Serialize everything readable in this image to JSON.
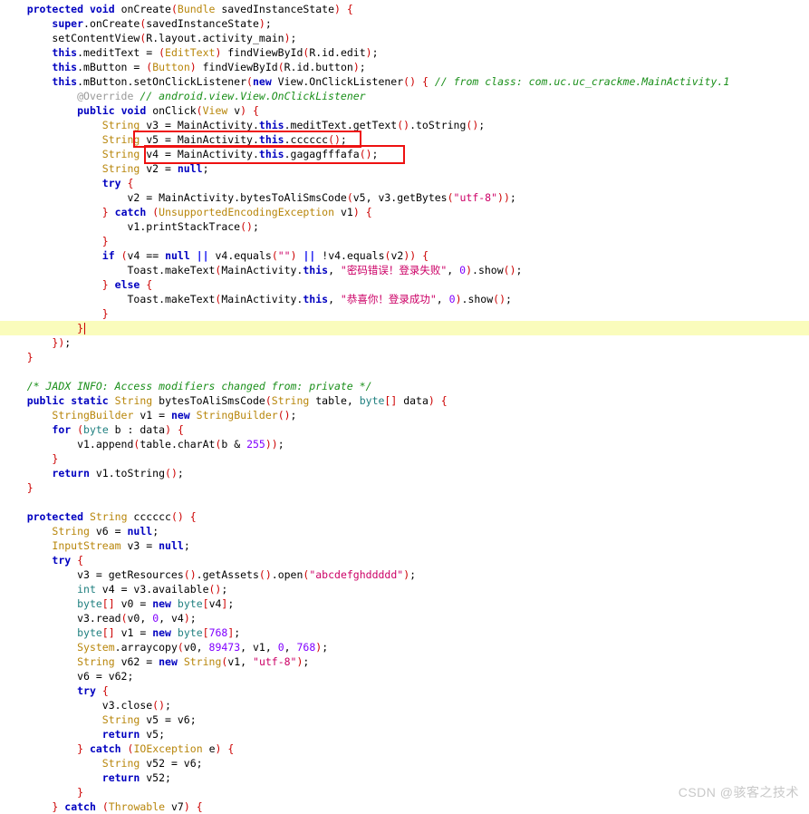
{
  "app": {
    "kind": "decompiler-code-view",
    "title": "JADX decompiled Java source",
    "watermark": "CSDN @骇客之技术"
  },
  "theme": {
    "background": "#ffffff",
    "keyword": "#0000c0",
    "class_name": "#b8860b",
    "string": "#cc0066",
    "number": "#8000ff",
    "comment": "#1a8f1a",
    "punctuation": "#cc0000",
    "annotation": "#999999",
    "highlight_line": "#fafcbc",
    "annotation_box": "#ee1111",
    "watermark": "#c8c8c8"
  },
  "annotations": {
    "boxes": [
      {
        "name": "highlight-box-cccccc",
        "target_text": "v5 = MainActivity.this.cccccc();"
      },
      {
        "name": "highlight-box-gagagfffafa",
        "target_text": "v4 = MainActivity.this.gagagfffafa();"
      }
    ],
    "highlighted_line_index": 21
  },
  "code": {
    "lines": [
      "    protected void onCreate(Bundle savedInstanceState) {",
      "        super.onCreate(savedInstanceState);",
      "        setContentView(R.layout.activity_main);",
      "        this.meditText = (EditText) findViewById(R.id.edit);",
      "        this.mButton = (Button) findViewById(R.id.button);",
      "        this.mButton.setOnClickListener(new View.OnClickListener() { // from class: com.uc.uc_crackme.MainActivity.1",
      "            @Override // android.view.View.OnClickListener",
      "            public void onClick(View v) {",
      "                String v3 = MainActivity.this.meditText.getText().toString();",
      "                String v5 = MainActivity.this.cccccc();",
      "                String v4 = MainActivity.this.gagagfffafa();",
      "                String v2 = null;",
      "                try {",
      "                    v2 = MainActivity.bytesToAliSmsCode(v5, v3.getBytes(\"utf-8\"));",
      "                } catch (UnsupportedEncodingException v1) {",
      "                    v1.printStackTrace();",
      "                }",
      "                if (v4 == null || v4.equals(\"\") || !v4.equals(v2)) {",
      "                    Toast.makeText(MainActivity.this, \"密码错误！登录失败\", 0).show();",
      "                } else {",
      "                    Toast.makeText(MainActivity.this, \"恭喜你！登录成功\", 0).show();",
      "                }",
      "            }",
      "        });",
      "    }",
      "",
      "    /* JADX INFO: Access modifiers changed from: private */",
      "    public static String bytesToAliSmsCode(String table, byte[] data) {",
      "        StringBuilder v1 = new StringBuilder();",
      "        for (byte b : data) {",
      "            v1.append(table.charAt(b & 255));",
      "        }",
      "        return v1.toString();",
      "    }",
      "",
      "    protected String cccccc() {",
      "        String v6 = null;",
      "        InputStream v3 = null;",
      "        try {",
      "            v3 = getResources().getAssets().open(\"abcdefghddddd\");",
      "            int v4 = v3.available();",
      "            byte[] v0 = new byte[v4];",
      "            v3.read(v0, 0, v4);",
      "            byte[] v1 = new byte[768];",
      "            System.arraycopy(v0, 89473, v1, 0, 768);",
      "            String v62 = new String(v1, \"utf-8\");",
      "            v6 = v62;",
      "            try {",
      "                v3.close();",
      "                String v5 = v6;",
      "                return v5;",
      "            } catch (IOException e) {",
      "                String v52 = v6;",
      "                return v52;",
      "            }",
      "        } catch (Throwable v7) {"
    ],
    "strings": [
      "\"utf-8\"",
      "\"\"",
      "\"密码错误！登录失败\"",
      "\"恭喜你！登录成功\"",
      "\"abcdefghddddd\""
    ],
    "numbers": [
      "0",
      "255",
      "768",
      "89473"
    ],
    "method_names": [
      "onCreate",
      "onClick",
      "bytesToAliSmsCode",
      "cccccc",
      "gagagfffafa"
    ],
    "class_names": [
      "MainActivity",
      "Bundle",
      "EditText",
      "Button",
      "View.OnClickListener",
      "StringBuilder",
      "InputStream",
      "String",
      "Toast",
      "UnsupportedEncodingException",
      "IOException",
      "Throwable"
    ],
    "comments": [
      "// from class: com.uc.uc_crackme.MainActivity.1",
      "// android.view.View.OnClickListener",
      "/* JADX INFO: Access modifiers changed from: private */"
    ]
  }
}
